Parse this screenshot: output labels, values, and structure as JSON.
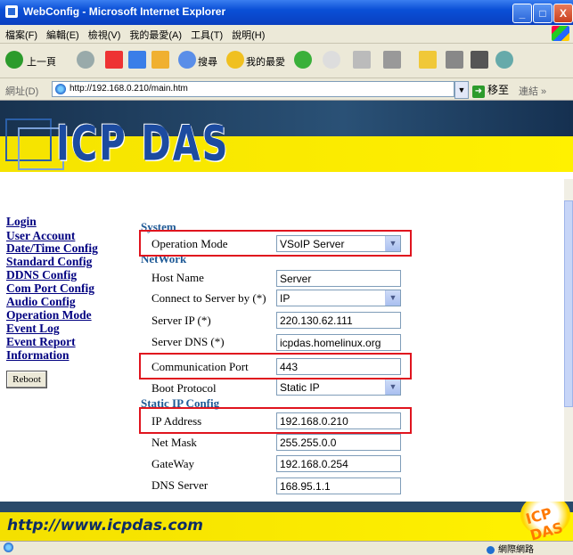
{
  "window": {
    "title": "WebConfig - Microsoft Internet Explorer",
    "minimize": "_",
    "maximize": "□",
    "close": "X"
  },
  "menu": [
    "檔案(F)",
    "編輯(E)",
    "檢視(V)",
    "我的最愛(A)",
    "工具(T)",
    "說明(H)"
  ],
  "toolbar": {
    "back": "上一頁",
    "search": "搜尋",
    "favorites": "我的最愛"
  },
  "address": {
    "label": "網址(D)",
    "url": "http://192.168.0.210/main.htm",
    "go": "移至",
    "links": "連結 »"
  },
  "banner": {
    "logo": "ICP DAS"
  },
  "sidebar": {
    "links": [
      "Login",
      "User Account",
      "Date/Time Config",
      "Standard Config",
      "DDNS Config",
      "Com Port Config",
      "Audio Config",
      "Operation Mode",
      "Event Log",
      "Event Report",
      "Information"
    ],
    "reboot": "Reboot"
  },
  "form": {
    "system_title": "System",
    "operation_mode_label": "Operation Mode",
    "operation_mode_value": "VSoIP Server",
    "network_title": "NetWork",
    "host_name_label": "Host Name",
    "host_name_value": "Server",
    "connect_label": "Connect to Server by (*)",
    "connect_value": "IP",
    "server_ip_label": "Server IP (*)",
    "server_ip_value": "220.130.62.111",
    "server_dns_label": "Server DNS (*)",
    "server_dns_value": "icpdas.homelinux.org",
    "comm_port_label": "Communication Port",
    "comm_port_value": "443",
    "boot_protocol_label": "Boot Protocol",
    "boot_protocol_value": "Static IP",
    "static_title": "Static IP Config",
    "ip_label": "IP Address",
    "ip_value": "192.168.0.210",
    "netmask_label": "Net Mask",
    "netmask_value": "255.255.0.0",
    "gateway_label": "GateWay",
    "gateway_value": "192.168.0.254",
    "dns_label": "DNS Server",
    "dns_value": "168.95.1.1"
  },
  "footer": {
    "url": "http://www.icpdas.com",
    "badge": "ICP DAS"
  },
  "status": {
    "zone": "網際網路"
  },
  "colors": {
    "highlight": "#e0141e",
    "link": "#000080",
    "section": "#1f5a96",
    "banner_yellow": "#fff100"
  }
}
